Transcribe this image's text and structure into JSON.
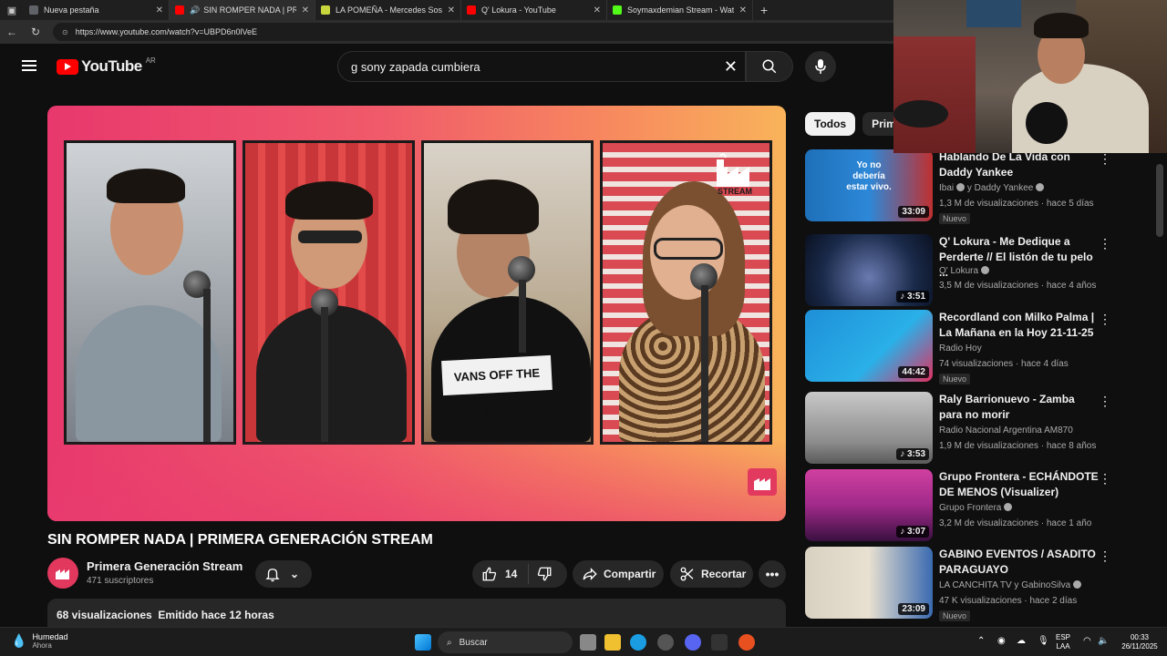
{
  "browser": {
    "tabs": [
      {
        "title": "Nueva pestaña",
        "active": false,
        "favicon_color": "#5f6368"
      },
      {
        "title": "SIN ROMPER NADA | PRIMERA GENERACIÓN STREAM",
        "active": true,
        "favicon_color": "#ff0000"
      },
      {
        "title": "LA POMEÑA - Mercedes Sosa - Letra",
        "active": false,
        "favicon_color": "#e6f05a"
      },
      {
        "title": "Q' Lokura - YouTube",
        "active": false,
        "favicon_color": "#ff0000"
      },
      {
        "title": "Soymaxdemian Stream - Watch Live",
        "active": false,
        "favicon_color": "#53fc18"
      }
    ],
    "url": "https://www.youtube.com/watch?v=UBPD6n0lVeE"
  },
  "header": {
    "logo_text": "YouTube",
    "country_code": "AR",
    "search_value": "g sony zapada cumbiera"
  },
  "video": {
    "title": "SIN ROMPER NADA | PRIMERA GENERACIÓN STREAM",
    "stream_label": "STREAM",
    "channel": "Primera Generación Stream",
    "subscribers": "471 suscriptores",
    "likes": "14",
    "share_label": "Compartir",
    "clip_label": "Recortar",
    "description_meta": "68 visualizaciones  Emitido hace 12 horas",
    "shirt_text": "VANS OFF THE WALL"
  },
  "sidebar": {
    "chips": [
      "Todos",
      "Primeros"
    ],
    "recommendations": [
      {
        "title": "Hablando De La Vida con Daddy Yankee",
        "channel": "Ibai",
        "channel_extra": "y Daddy Yankee",
        "meta": "1,3 M de visualizaciones · hace 5 días",
        "duration": "33:09",
        "badge": "Nuevo",
        "thumb_text": "Yo no debería estar vivo.",
        "thumb_color": "#1e6fb8"
      },
      {
        "title": "Q' Lokura - Me Dedique a Perderte // El listón de tu pelo ...",
        "channel": "Q' Lokura",
        "meta": "3,5 M de visualizaciones · hace 4 años",
        "duration": "3:51",
        "badge": "",
        "thumb_color": "#1a2a4a"
      },
      {
        "title": "Recordland con Milko Palma | La Mañana en la Hoy 21-11-25",
        "channel": "Radio Hoy",
        "meta": "74 visualizaciones · hace 4 días",
        "duration": "44:42",
        "badge": "Nuevo",
        "thumb_color": "#1e8fd8"
      },
      {
        "title": "Raly Barrionuevo - Zamba para no morir",
        "channel": "Radio Nacional Argentina AM870",
        "meta": "1,9 M de visualizaciones · hace 8 años",
        "duration": "3:53",
        "badge": "",
        "thumb_color": "#8c8c8c"
      },
      {
        "title": "Grupo Frontera - ECHÁNDOTE DE MENOS (Visualizer)",
        "channel": "Grupo Frontera",
        "meta": "3,2 M de visualizaciones · hace 1 año",
        "duration": "3:07",
        "badge": "",
        "thumb_color": "#a02a8a"
      },
      {
        "title": "GABINO EVENTOS / ASADITO PARAGUAYO",
        "channel": "LA CANCHITA TV y GabinoSilva",
        "meta": "47 K visualizaciones · hace 2 días",
        "duration": "23:09",
        "badge": "Nuevo",
        "thumb_color": "#d8d0c0"
      }
    ]
  },
  "taskbar": {
    "weather_title": "Humedad",
    "weather_sub": "Ahora",
    "search_label": "Buscar",
    "lang_top": "ESP",
    "lang_bottom": "LAA",
    "time": "00:33",
    "date": "26/11/2025"
  },
  "colors": {
    "brand_red": "#ff0000",
    "background": "#0f0f0f",
    "player_gradient_start": "#e8386d",
    "player_gradient_end": "#f9b35a"
  }
}
